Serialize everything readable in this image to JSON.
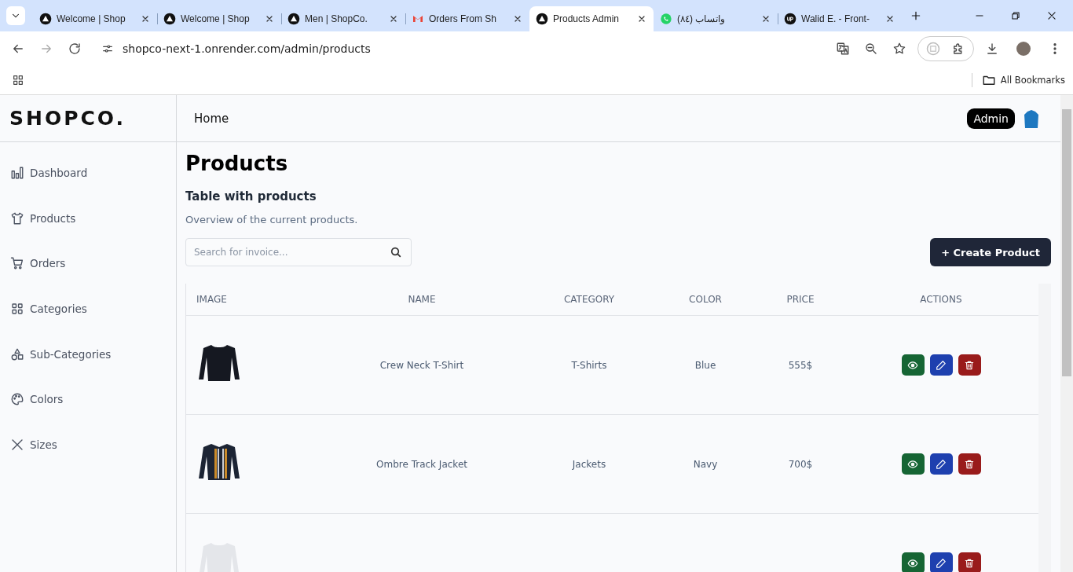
{
  "browser": {
    "tabs": [
      {
        "title": "Welcome | Shop",
        "kind": "triangle",
        "selected": false
      },
      {
        "title": "Welcome | Shop",
        "kind": "triangle",
        "selected": false
      },
      {
        "title": "Men | ShopCo.",
        "kind": "triangle",
        "selected": false
      },
      {
        "title": "Orders From Sh",
        "kind": "mail",
        "selected": false
      },
      {
        "title": "Products Admin",
        "kind": "triangle",
        "selected": true
      },
      {
        "title": "(٨٤) واتساب",
        "kind": "chat",
        "selected": false
      },
      {
        "title": "Walid E. - Front-",
        "kind": "up",
        "selected": false
      }
    ],
    "url": "shopco-next-1.onrender.com/admin/products",
    "bookmarks_folder": "All Bookmarks"
  },
  "app": {
    "logo": "SHOPCO.",
    "nav_link": "Home",
    "role_badge": "Admin",
    "sidebar": [
      {
        "label": "Dashboard",
        "kind": "chart"
      },
      {
        "label": "Products",
        "kind": "shirt"
      },
      {
        "label": "Orders",
        "kind": "cart"
      },
      {
        "label": "Categories",
        "kind": "grid"
      },
      {
        "label": "Sub-Categories",
        "kind": "shapes"
      },
      {
        "label": "Colors",
        "kind": "palette"
      },
      {
        "label": "Sizes",
        "kind": "x"
      }
    ],
    "title": "Products",
    "subtitle": "Table with products",
    "description": "Overview of the current products.",
    "search": {
      "placeholder": "Search for invoice..."
    },
    "create_button": "+ Create Product",
    "table": {
      "columns": [
        "IMAGE",
        "NAME",
        "CATEGORY",
        "COLOR",
        "PRICE",
        "ACTIONS"
      ],
      "rows": [
        {
          "kind": "sweater",
          "name": "Crew Neck T-Shirt",
          "category": "T-Shirts",
          "color_name": "Blue",
          "price": "555$"
        },
        {
          "kind": "jacket",
          "name": "Ombre Track Jacket",
          "category": "Jackets",
          "color_name": "Navy",
          "price": "700$"
        },
        {
          "kind": "light"
        }
      ]
    }
  }
}
